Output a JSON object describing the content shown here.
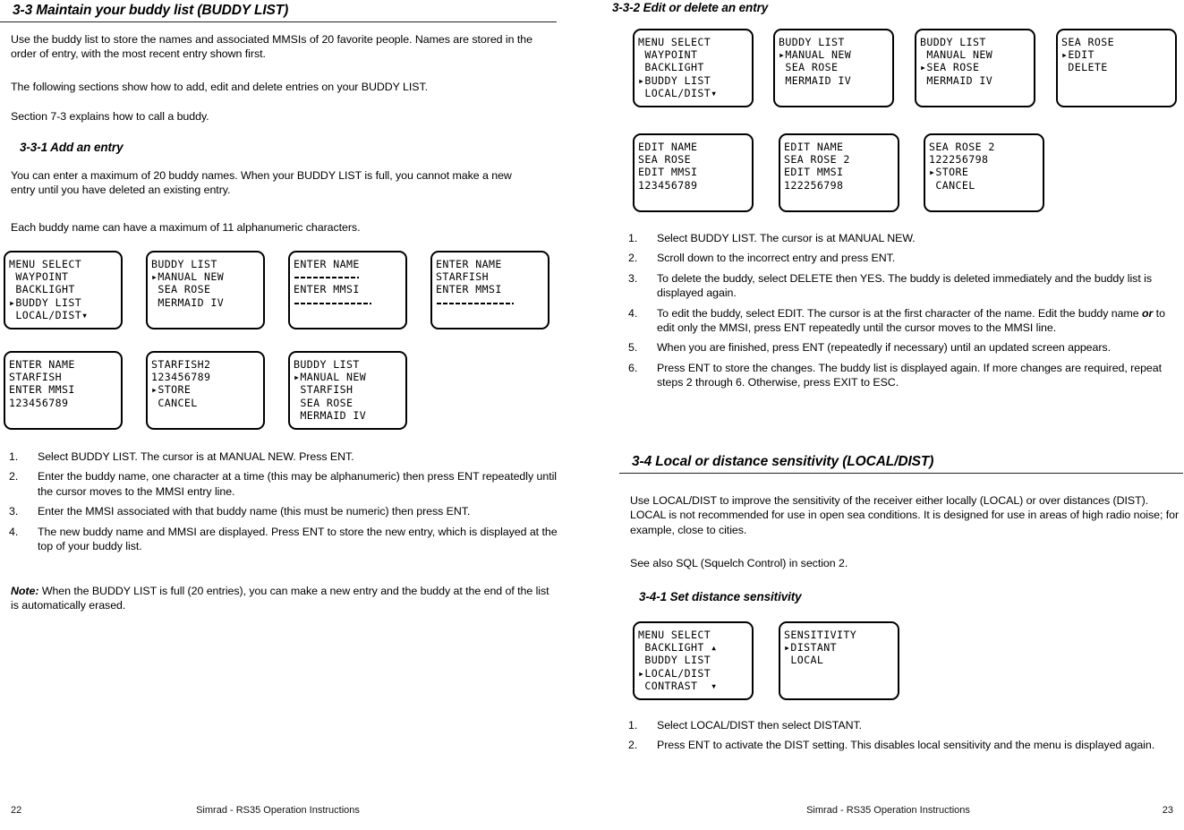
{
  "left_page": {
    "page_number": "22",
    "footer_text": "Simrad - RS35 Operation Instructions",
    "section": {
      "heading": "3-3 Maintain your buddy list (BUDDY LIST)",
      "paragraphs": [
        "Use the buddy list to store the names and associated MMSIs of 20 favorite people. Names are stored in the order of entry, with the most recent entry shown first.",
        "The following sections show how to add, edit and delete entries on your BUDDY LIST.",
        "Section 7-3 explains how to call a buddy."
      ]
    },
    "subsection": {
      "heading": "3-3-1 Add an entry",
      "paragraphs": [
        "You can enter a maximum of 20 buddy names. When your BUDDY LIST is full, you cannot make a new entry until you have deleted an existing entry.",
        "Each buddy name can have a maximum of 11 alphanumeric characters."
      ]
    },
    "screens_row1": [
      {
        "lines": [
          "MENU SELECT",
          " WAYPOINT",
          " BACKLIGHT",
          "▸BUDDY LIST",
          " LOCAL∕DIST▾"
        ]
      },
      {
        "lines": [
          "BUDDY LIST",
          "▸MANUAL NEW",
          " SEA ROSE",
          " MERMAID IV"
        ]
      },
      {
        "lines": [
          "ENTER NAME",
          "__DASH__",
          "ENTER MMSI",
          "__DASH_LONG__"
        ]
      },
      {
        "lines": [
          "ENTER NAME",
          "STARFISH",
          "ENTER MMSI",
          "__DASH_LONG__"
        ]
      }
    ],
    "screens_row2": [
      {
        "lines": [
          "ENTER NAME",
          "STARFISH",
          "ENTER MMSI",
          "123456789"
        ]
      },
      {
        "lines": [
          "STARFISH2",
          "123456789",
          "▸STORE",
          " CANCEL"
        ]
      },
      {
        "lines": [
          "BUDDY LIST",
          "▸MANUAL NEW",
          " STARFISH",
          " SEA ROSE",
          " MERMAID IV"
        ]
      }
    ],
    "steps": [
      {
        "num": "1.",
        "text": "Select BUDDY LIST.  The cursor is at MANUAL NEW.   Press ENT."
      },
      {
        "num": "2.",
        "text": "Enter the buddy name, one character at a time (this may be alphanumeric) then press ENT repeatedly until the cursor moves to the MMSI entry line."
      },
      {
        "num": "3.",
        "text": "Enter the MMSI associated with that buddy name (this must be numeric) then press ENT."
      },
      {
        "num": "4.",
        "text": "The new buddy name and MMSI are displayed. Press ENT to store the new entry, which is displayed at the top of your buddy list."
      }
    ],
    "note": {
      "lead": "Note:",
      "text": " When the BUDDY LIST is full (20 entries), you can make a new entry and the buddy at the end of the list is automatically erased."
    }
  },
  "right_page": {
    "page_number": "23",
    "footer_text": "Simrad - RS35 Operation Instructions",
    "subsection_edit": {
      "heading": "3-3-2 Edit or delete an entry"
    },
    "screens_row1": [
      {
        "lines": [
          "MENU SELECT",
          " WAYPOINT",
          " BACKLIGHT",
          "▸BUDDY LIST",
          " LOCAL∕DIST▾"
        ]
      },
      {
        "lines": [
          "BUDDY LIST",
          "▸MANUAL NEW",
          " SEA ROSE",
          " MERMAID IV"
        ]
      },
      {
        "lines": [
          "BUDDY LIST",
          " MANUAL NEW",
          "▸SEA ROSE",
          " MERMAID IV"
        ]
      },
      {
        "lines": [
          "SEA ROSE",
          "▸EDIT",
          " DELETE"
        ]
      }
    ],
    "screens_row2": [
      {
        "lines": [
          "EDIT NAME",
          "SEA ROSE",
          "EDIT MMSI",
          "123456789"
        ]
      },
      {
        "lines": [
          "EDIT NAME",
          "SEA ROSE 2",
          "EDIT MMSI",
          "122256798"
        ]
      },
      {
        "lines": [
          "SEA ROSE 2",
          "122256798",
          "▸STORE",
          " CANCEL"
        ]
      }
    ],
    "steps_edit": [
      {
        "num": "1.",
        "text": "Select BUDDY LIST.  The cursor is at MANUAL NEW."
      },
      {
        "num": "2.",
        "text": "Scroll down to the incorrect entry and press ENT."
      },
      {
        "num": "3.",
        "text": "To delete the buddy, select DELETE then YES. The buddy is deleted immediately and the buddy list is displayed again."
      },
      {
        "num": "4.",
        "text": "To edit the buddy, select EDIT. The cursor is at the first character of the name. Edit the buddy name ",
        "emph": "or",
        "text2": " to edit only the MMSI, press ENT repeatedly until the cursor moves to the MMSI line."
      },
      {
        "num": "5.",
        "text": "When you are finished, press ENT (repeatedly if necessary) until an updated screen appears."
      },
      {
        "num": "6.",
        "text": "Press ENT to store the changes. The buddy list is displayed again. If more changes are required, repeat steps 2 through 6. Otherwise, press EXIT to ESC."
      }
    ],
    "section_sensitivity": {
      "heading": "3-4 Local or distance sensitivity (LOCAL/DIST)",
      "paragraphs": [
        "Use LOCAL/DIST to improve the sensitivity of the receiver either locally (LOCAL) or over distances (DIST). LOCAL is not recommended for use in open sea conditions. It is designed for use in areas of high radio noise; for example, close to cities.",
        "See also SQL (Squelch Control) in section 2."
      ]
    },
    "subsection_distance": {
      "heading": "3-4-1 Set distance sensitivity"
    },
    "screens_row3": [
      {
        "lines": [
          "MENU SELECT",
          " BACKLIGHT ▴",
          " BUDDY LIST",
          "▸LOCAL∕DIST",
          " CONTRAST  ▾"
        ]
      },
      {
        "lines": [
          "SENSITIVITY",
          "▸DISTANT",
          " LOCAL"
        ]
      }
    ],
    "steps_distance": [
      {
        "num": "1.",
        "text": "Select LOCAL/DIST then select DISTANT."
      },
      {
        "num": "2.",
        "text": "Press ENT to activate the DIST setting. This disables local sensitivity and the menu is displayed again."
      }
    ]
  }
}
